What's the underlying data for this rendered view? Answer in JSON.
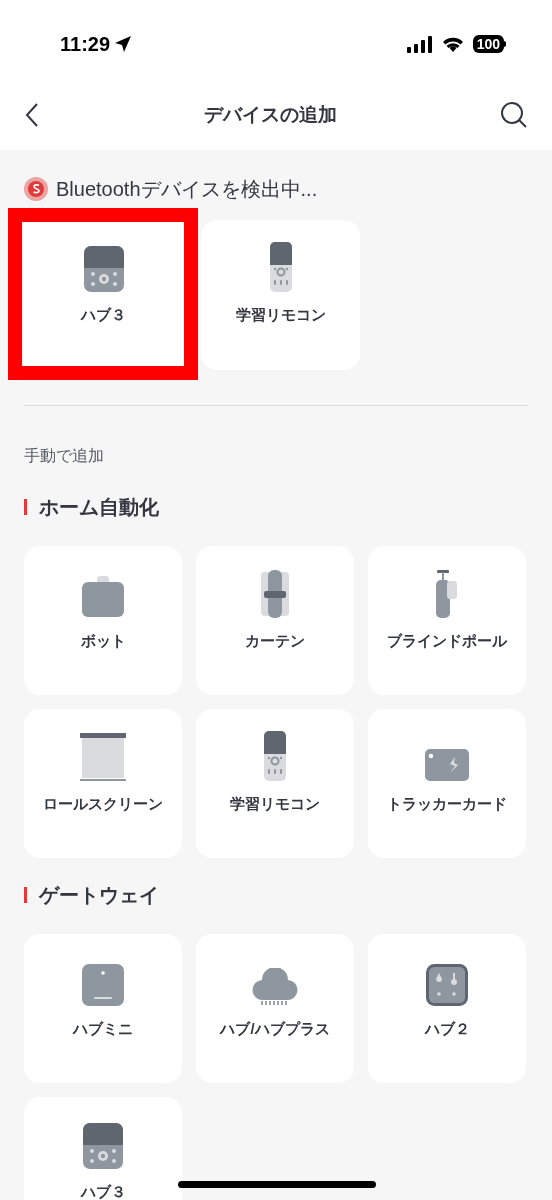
{
  "status_bar": {
    "time": "11:29",
    "battery": "100"
  },
  "header": {
    "title": "デバイスの追加"
  },
  "scanning": {
    "label": "Bluetoothデバイスを検出中..."
  },
  "discovered": [
    {
      "kind": "hub3",
      "label": "ハブ３",
      "highlighted": true
    },
    {
      "kind": "remote",
      "label": "学習リモコン",
      "highlighted": false
    }
  ],
  "manual_label": "手動で追加",
  "sections": [
    {
      "title": "ホーム自動化",
      "items": [
        {
          "kind": "bot",
          "label": "ボット"
        },
        {
          "kind": "curtain",
          "label": "カーテン"
        },
        {
          "kind": "blindpole",
          "label": "ブラインドポール"
        },
        {
          "kind": "rollscreen",
          "label": "ロールスクリーン"
        },
        {
          "kind": "remote",
          "label": "学習リモコン"
        },
        {
          "kind": "tracker",
          "label": "トラッカーカード"
        }
      ]
    },
    {
      "title": "ゲートウェイ",
      "items": [
        {
          "kind": "hubmini",
          "label": "ハブミニ"
        },
        {
          "kind": "hubplus",
          "label": "ハブ/ハブプラス"
        },
        {
          "kind": "hub2",
          "label": "ハブ２"
        },
        {
          "kind": "hub3",
          "label": "ハブ３"
        }
      ]
    }
  ]
}
